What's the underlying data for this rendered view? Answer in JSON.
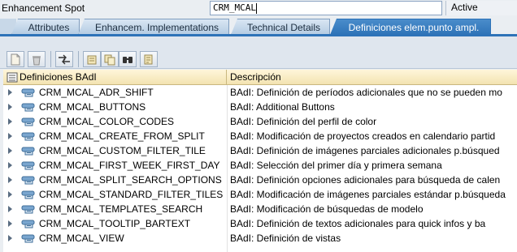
{
  "header": {
    "spot_label": "Enhancement Spot",
    "spot_value": "CRM_MCAL",
    "status": "Active"
  },
  "tabs": [
    {
      "label": "Attributes",
      "active": false
    },
    {
      "label": "Enhancem. Implementations",
      "active": false
    },
    {
      "label": "Technical Details",
      "active": false
    },
    {
      "label": "Definiciones elem.punto ampl.",
      "active": true
    }
  ],
  "toolbar": {
    "buttons": [
      {
        "icon": "new-document-icon"
      },
      {
        "icon": "delete-icon"
      },
      {
        "icon": "move-arrows-icon"
      },
      {
        "icon": "details-icon"
      },
      {
        "icon": "copy-icon"
      },
      {
        "icon": "find-icon"
      },
      {
        "icon": "documentation-icon"
      }
    ]
  },
  "table": {
    "columns": [
      "Definiciones BAdI",
      "Descripción"
    ],
    "rows": [
      {
        "name": "CRM_MCAL_ADR_SHIFT",
        "desc": "BAdI: Definición de períodos adicionales que no se pueden mo"
      },
      {
        "name": "CRM_MCAL_BUTTONS",
        "desc": "BAdI: Additional Buttons"
      },
      {
        "name": "CRM_MCAL_COLOR_CODES",
        "desc": "BAdI: Definición del perfil de color"
      },
      {
        "name": "CRM_MCAL_CREATE_FROM_SPLIT",
        "desc": "BAdI: Modificación de proyectos creados en calendario partid"
      },
      {
        "name": "CRM_MCAL_CUSTOM_FILTER_TILE",
        "desc": "BAdI: Definición de imágenes parciales adicionales p.búsqued"
      },
      {
        "name": "CRM_MCAL_FIRST_WEEK_FIRST_DAY",
        "desc": "BAdI: Selección del primer día y primera semana"
      },
      {
        "name": "CRM_MCAL_SPLIT_SEARCH_OPTIONS",
        "desc": "BAdI: Definición opciones adicionales para búsqueda de calen"
      },
      {
        "name": "CRM_MCAL_STANDARD_FILTER_TILES",
        "desc": "BAdI: Modificación de imágenes parciales estándar p.búsqueda"
      },
      {
        "name": "CRM_MCAL_TEMPLATES_SEARCH",
        "desc": "BAdI: Modificación de búsquedas de modelo"
      },
      {
        "name": "CRM_MCAL_TOOLTIP_BARTEXT",
        "desc": "BAdI: Definición de textos adicionales para quick infos y ba"
      },
      {
        "name": "CRM_MCAL_VIEW",
        "desc": "BAdI: Definición de vistas"
      }
    ]
  },
  "colors": {
    "tab_active": "#2e73b8",
    "header_bg": "#f3e3b1"
  }
}
